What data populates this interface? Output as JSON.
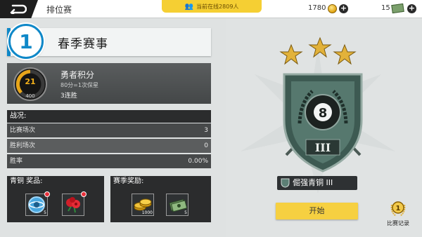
{
  "topbar": {
    "title": "排位赛",
    "online_text": "当前在线2809人",
    "coins": "1780",
    "cash": "15"
  },
  "event": {
    "number": "1",
    "title": "春季赛事"
  },
  "brave": {
    "gauge_value": "21",
    "gauge_max": "400",
    "title": "勇者积分",
    "subtitle": "80分=1次保星",
    "streak": "3连胜"
  },
  "stats": {
    "header": "战况:",
    "rows": [
      {
        "label": "比赛场次",
        "value": "3"
      },
      {
        "label": "胜利场次",
        "value": "0"
      },
      {
        "label": "胜率",
        "value": "0.00%"
      }
    ]
  },
  "rank_rewards": {
    "header": "青铜 奖品:",
    "items": [
      {
        "icon": "token-icon",
        "count": "5"
      },
      {
        "icon": "rose-icon",
        "count": ""
      }
    ]
  },
  "season_rewards": {
    "header": "赛季奖励:",
    "items": [
      {
        "icon": "coin-stack-icon",
        "count": "1000"
      },
      {
        "icon": "cash-icon",
        "count": "5"
      }
    ]
  },
  "rank": {
    "name": "倔强青铜 III",
    "tier_numeral": "III",
    "stars": 3
  },
  "actions": {
    "start_label": "开始",
    "record_label": "比赛记录"
  },
  "colors": {
    "accent_blue": "#0f88c8",
    "start_yellow": "#f6d041",
    "online_yellow": "#f5cf33"
  }
}
